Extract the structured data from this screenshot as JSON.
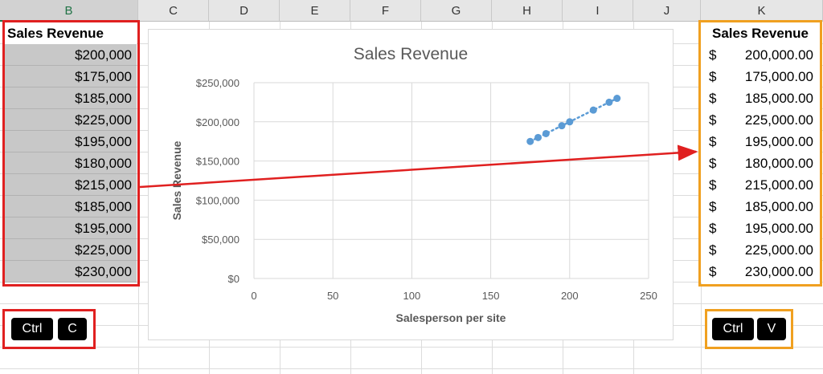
{
  "columns": [
    "B",
    "C",
    "D",
    "E",
    "F",
    "G",
    "H",
    "I",
    "J",
    "K"
  ],
  "left_table": {
    "header": "Sales Revenue",
    "values": [
      "$200,000",
      "$175,000",
      "$185,000",
      "$225,000",
      "$195,000",
      "$180,000",
      "$215,000",
      "$185,000",
      "$195,000",
      "$225,000",
      "$230,000"
    ]
  },
  "right_table": {
    "header": "Sales Revenue",
    "currency": "$",
    "values": [
      "200,000.00",
      "175,000.00",
      "185,000.00",
      "225,000.00",
      "195,000.00",
      "180,000.00",
      "215,000.00",
      "185,000.00",
      "195,000.00",
      "225,000.00",
      "230,000.00"
    ]
  },
  "shortcuts": {
    "copy": {
      "ctrl": "Ctrl",
      "key": "C"
    },
    "paste": {
      "ctrl": "Ctrl",
      "key": "V"
    }
  },
  "colors": {
    "copy_box": "#e02020",
    "paste_box": "#f0a020",
    "arrow": "#e02020",
    "series": "#5b9bd5"
  },
  "chart_data": {
    "type": "scatter",
    "title": "Sales Revenue",
    "xlabel": "Salesperson per site",
    "ylabel": "Sales Revenue",
    "xlim": [
      0,
      250
    ],
    "ylim": [
      0,
      250000
    ],
    "x_ticks": [
      "0",
      "50",
      "100",
      "150",
      "200",
      "250"
    ],
    "y_ticks": [
      "$0",
      "$50,000",
      "$100,000",
      "$150,000",
      "$200,000",
      "$250,000"
    ],
    "trendline": "linear, dotted",
    "points": [
      {
        "x": 175,
        "y": 175000
      },
      {
        "x": 180,
        "y": 180000
      },
      {
        "x": 185,
        "y": 185000
      },
      {
        "x": 195,
        "y": 195000
      },
      {
        "x": 200,
        "y": 200000
      },
      {
        "x": 215,
        "y": 215000
      },
      {
        "x": 225,
        "y": 225000
      },
      {
        "x": 230,
        "y": 230000
      }
    ]
  }
}
